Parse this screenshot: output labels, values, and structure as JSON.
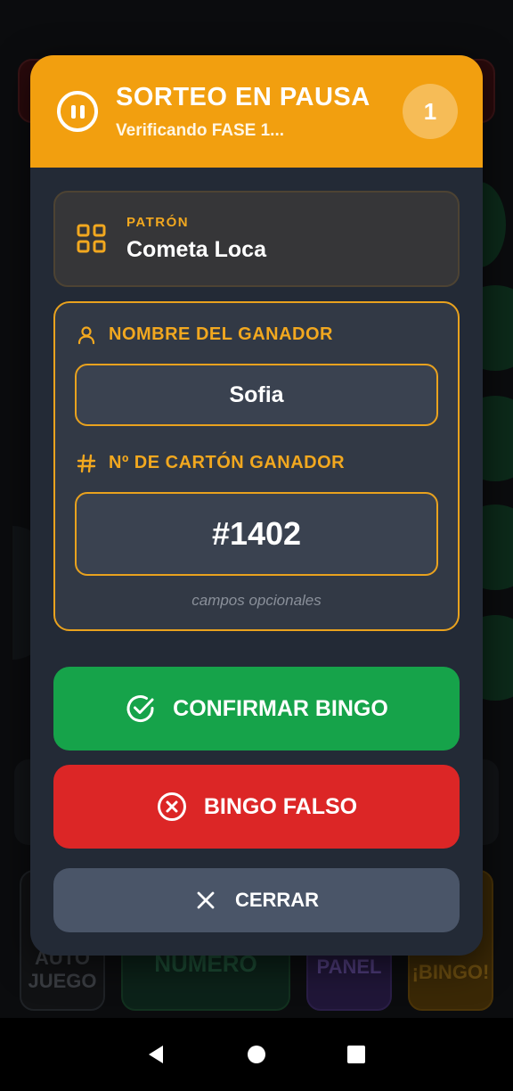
{
  "background": {
    "buttons": {
      "auto_juego": "AUTO\nJUEGO",
      "numero": "NÚMERO",
      "panel": "PANEL",
      "bingo": "¡BINGO!"
    }
  },
  "modal": {
    "header": {
      "title": "SORTEO EN PAUSA",
      "subtitle": "Verificando FASE 1...",
      "phase_badge": "1",
      "accent_color": "#f29f0f"
    },
    "pattern": {
      "label": "PATRÓN",
      "value": "Cometa Loca"
    },
    "winner_form": {
      "name_label": "NOMBRE DEL GANADOR",
      "name_value": "Sofia",
      "card_label": "Nº DE CARTÓN GANADOR",
      "card_value": "#1402",
      "hint": "campos opcionales"
    },
    "actions": {
      "confirm_label": "CONFIRMAR BINGO",
      "confirm_color": "#16a34a",
      "false_label": "BINGO FALSO",
      "false_color": "#dc2626",
      "close_label": "CERRAR",
      "close_color": "#4a5568"
    }
  },
  "icons": {
    "header": "pause-icon",
    "pattern": "grid-icon",
    "name": "person-icon",
    "card": "hash-icon",
    "confirm": "check-circle-icon",
    "false": "x-circle-icon",
    "close": "close-icon",
    "nav": [
      "back-icon",
      "home-icon",
      "recents-icon"
    ]
  }
}
